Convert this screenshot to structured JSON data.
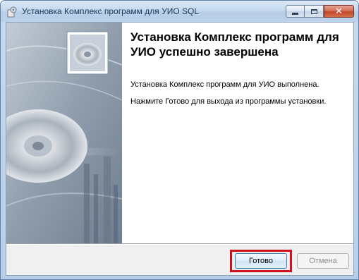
{
  "window": {
    "title": "Установка Комплекс программ для УИО SQL",
    "controls": {
      "minimize": "minimize-icon",
      "maximize": "maximize-icon",
      "close": "close-icon"
    }
  },
  "content": {
    "heading": "Установка Комплекс программ для УИО успешно завершена",
    "message_done": "Установка Комплекс программ для УИО выполнена.",
    "message_instruction": "Нажмите Готово для выхода из программы установки."
  },
  "buttons": {
    "finish": "Готово",
    "cancel": "Отмена"
  },
  "colors": {
    "highlight": "#d0101c",
    "side_panel": "#7f8fa0"
  }
}
